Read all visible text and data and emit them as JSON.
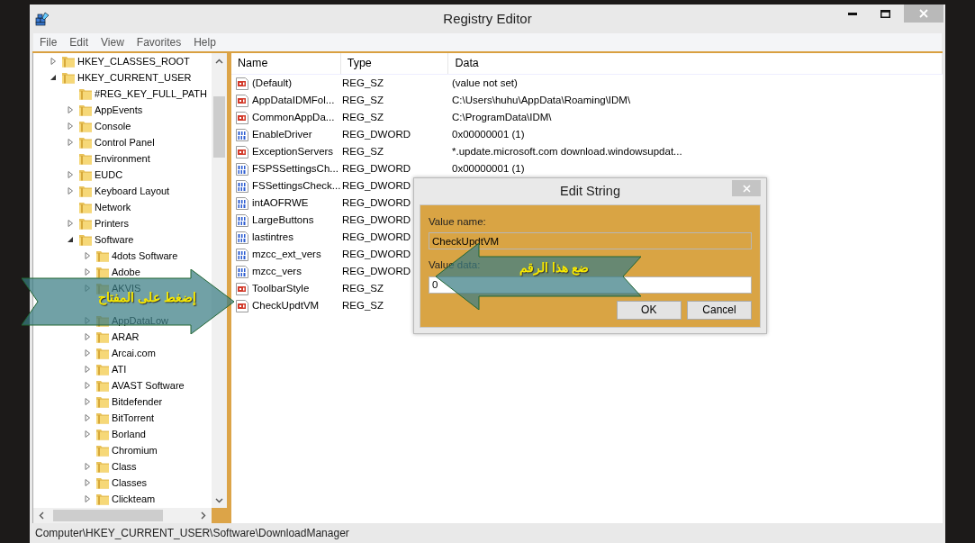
{
  "window": {
    "title": "Registry Editor"
  },
  "menu": [
    {
      "label": "File"
    },
    {
      "label": "Edit"
    },
    {
      "label": "View"
    },
    {
      "label": "Favorites"
    },
    {
      "label": "Help"
    }
  ],
  "tree": [
    {
      "label": "HKEY_CLASSES_ROOT",
      "kind": "key",
      "expanded": false
    },
    {
      "label": "HKEY_CURRENT_USER",
      "kind": "key",
      "expanded": true,
      "children": [
        {
          "label": "#REG_KEY_FULL_PATH",
          "kind": "leaf"
        },
        {
          "label": "AppEvents",
          "kind": "key",
          "expanded": false
        },
        {
          "label": "Console",
          "kind": "key",
          "expanded": false
        },
        {
          "label": "Control Panel",
          "kind": "key",
          "expanded": false
        },
        {
          "label": "Environment",
          "kind": "leaf"
        },
        {
          "label": "EUDC",
          "kind": "key",
          "expanded": false
        },
        {
          "label": "Keyboard Layout",
          "kind": "key",
          "expanded": false
        },
        {
          "label": "Network",
          "kind": "leaf"
        },
        {
          "label": "Printers",
          "kind": "key",
          "expanded": false
        },
        {
          "label": "Software",
          "kind": "key",
          "expanded": true,
          "children": [
            {
              "label": "4dots Software",
              "kind": "key",
              "expanded": false
            },
            {
              "label": "Adobe",
              "kind": "key",
              "expanded": false
            },
            {
              "label": "AKVIS",
              "kind": "key",
              "expanded": false
            },
            {
              "kind": "covered"
            },
            {
              "label": "AppDataLow",
              "kind": "key",
              "expanded": false
            },
            {
              "label": "ARAR",
              "kind": "key",
              "expanded": false
            },
            {
              "label": "Arcai.com",
              "kind": "key",
              "expanded": false
            },
            {
              "label": "ATI",
              "kind": "key",
              "expanded": false
            },
            {
              "label": "AVAST Software",
              "kind": "key",
              "expanded": false
            },
            {
              "label": "Bitdefender",
              "kind": "key",
              "expanded": false
            },
            {
              "label": "BitTorrent",
              "kind": "key",
              "expanded": false
            },
            {
              "label": "Borland",
              "kind": "key",
              "expanded": false
            },
            {
              "label": "Chromium",
              "kind": "leaf"
            },
            {
              "label": "Class",
              "kind": "key",
              "expanded": false
            },
            {
              "label": "Classes",
              "kind": "key",
              "expanded": false
            },
            {
              "label": "Clickteam",
              "kind": "key",
              "expanded": false
            }
          ]
        }
      ]
    }
  ],
  "columns": [
    "Name",
    "Type",
    "Data"
  ],
  "values": [
    {
      "kind": "string",
      "name": "(Default)",
      "type": "REG_SZ",
      "data": "(value not set)"
    },
    {
      "kind": "string",
      "name": "AppDataIDMFol...",
      "type": "REG_SZ",
      "data": "C:\\Users\\huhu\\AppData\\Roaming\\IDM\\"
    },
    {
      "kind": "string",
      "name": "CommonAppDa...",
      "type": "REG_SZ",
      "data": "C:\\ProgramData\\IDM\\"
    },
    {
      "kind": "dword",
      "name": "EnableDriver",
      "type": "REG_DWORD",
      "data": "0x00000001 (1)"
    },
    {
      "kind": "string",
      "name": "ExceptionServers",
      "type": "REG_SZ",
      "data": "*.update.microsoft.com download.windowsupdat..."
    },
    {
      "kind": "dword",
      "name": "FSPSSettingsCh...",
      "type": "REG_DWORD",
      "data": "0x00000001 (1)"
    },
    {
      "kind": "dword",
      "name": "FSSettingsCheck...",
      "type": "REG_DWORD"
    },
    {
      "kind": "dword",
      "name": "intAOFRWE",
      "type": "REG_DWORD"
    },
    {
      "kind": "dword",
      "name": "LargeButtons",
      "type": "REG_DWORD"
    },
    {
      "kind": "dword",
      "name": "lastintres",
      "type": "REG_DWORD"
    },
    {
      "kind": "dword",
      "name": "mzcc_ext_vers",
      "type": "REG_DWORD"
    },
    {
      "kind": "dword",
      "name": "mzcc_vers",
      "type": "REG_DWORD"
    },
    {
      "kind": "string",
      "name": "ToolbarStyle",
      "type": "REG_SZ"
    },
    {
      "kind": "string",
      "name": "CheckUpdtVM",
      "type": "REG_SZ"
    }
  ],
  "status_bar": "Computer\\HKEY_CURRENT_USER\\Software\\DownloadManager",
  "dialog": {
    "title": "Edit String",
    "name_label": "Value name:",
    "name_value": "CheckUpdtVM",
    "data_label": "Value data:",
    "data_value": "0",
    "buttons": [
      "OK",
      "Cancel"
    ]
  },
  "callouts": [
    {
      "text": "إضغط على المفتاح",
      "kind": "rightward"
    },
    {
      "text": "ضع هذا الرقم",
      "kind": "leftward"
    }
  ]
}
